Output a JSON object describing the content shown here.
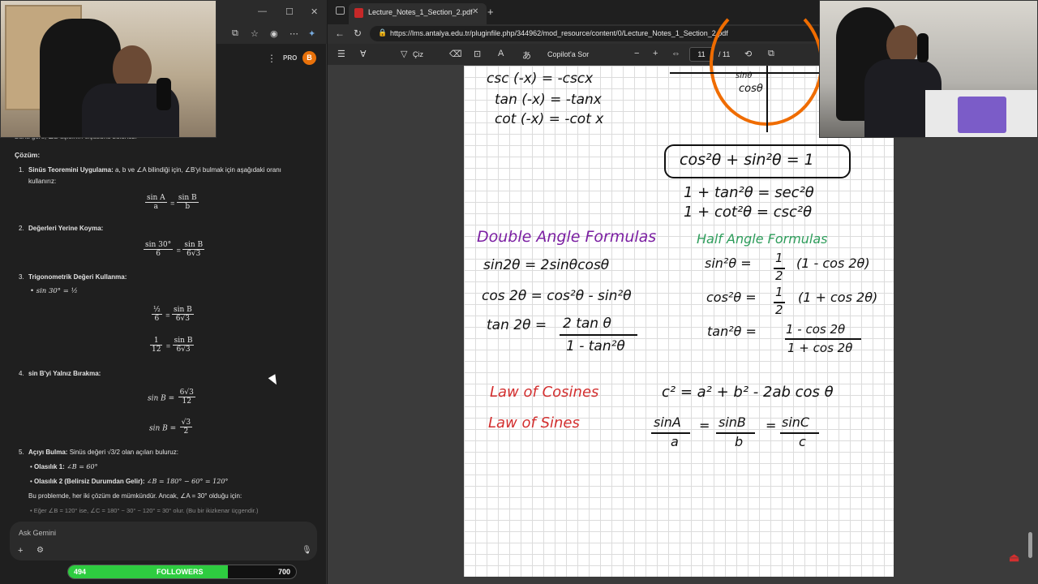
{
  "gemini": {
    "window_controls": [
      "—",
      "☐",
      "✕"
    ],
    "pro_label": "PRO",
    "avatar_letter": "B",
    "truncated_line": "Buna göre, ∠B açısının ölçüsünü bulunuz.",
    "solution_heading": "Çözüm:",
    "steps": {
      "s1_title": "Sinüs Teoremini Uygulama:",
      "s1_text": "a, b ve ∠A bilindiği için, ∠B'yi bulmak için aşağıdaki oranı",
      "s1_text2": "kullanırız:",
      "s1_eq_l_num": "sin A",
      "s1_eq_l_den": "a",
      "s1_eq_r_num": "sin B",
      "s1_eq_r_den": "b",
      "s2_title": "Değerleri Yerine Koyma:",
      "s2_eq_l_num": "sin 30°",
      "s2_eq_l_den": "6",
      "s2_eq_r_num": "sin B",
      "s2_eq_r_den": "6√3",
      "s3_title": "Trigonometrik Değeri Kullanma:",
      "s3_bullet": "sin 30° = ½",
      "s3_eq1_l_num": "½",
      "s3_eq1_l_den": "6",
      "s3_eq1_r_num": "sin B",
      "s3_eq1_r_den": "6√3",
      "s3_eq2_l_num": "1",
      "s3_eq2_l_den": "12",
      "s3_eq2_r_num": "sin B",
      "s3_eq2_r_den": "6√3",
      "s4_title": "sin B'yi Yalnız Bırakma:",
      "s4_eq1_l": "sin B =",
      "s4_eq1_num": "6√3",
      "s4_eq1_den": "12",
      "s4_eq2_l": "sin B =",
      "s4_eq2_num": "√3",
      "s4_eq2_den": "2",
      "s5_title": "Açıyı Bulma:",
      "s5_text": "Sinüs değeri √3/2 olan açıları buluruz:",
      "s5_b1_label": "Olasılık 1:",
      "s5_b1_val": "∠B = 60°",
      "s5_b2_label": "Olasılık 2 (Belirsiz Durumdan Gelir):",
      "s5_b2_val": "∠B = 180° − 60° = 120°",
      "s5_note": "Bu problemde, her iki çözüm de mümkündür. Ancak, ∠A = 30° olduğu için:",
      "s5_sub": "Eğer ∠B = 120° ise, ∠C = 180° − 30° − 120° = 30° olur. (Bu bir ikizkenar üçgendir.)"
    },
    "step_numbers": [
      "1.",
      "2.",
      "3.",
      "4.",
      "5."
    ],
    "ask_placeholder": "Ask Gemini"
  },
  "followers": {
    "left": "494",
    "label": "FOLLOWERS",
    "right": "700",
    "progress": 0.7
  },
  "browser": {
    "tab_title": "Lecture_Notes_1_Section_2.pdf",
    "url": "https://lms.antalya.edu.tr/pluginfile.php/344962/mod_resource/content/0/Lecture_Notes_1_Section_2.pdf",
    "toolbar": {
      "draw_label": "Çiz",
      "copilot_label": "Copilot'a Sor",
      "zoom_minus": "−",
      "zoom_plus": "+",
      "page_current": "11",
      "page_total": "/ 11"
    }
  },
  "notes": {
    "neg1": "csc (-x) = -cscx",
    "neg2": "tan (-x) = -tanx",
    "neg3": "cot (-x) = -cot x",
    "circle_label_top": "sinθ",
    "circle_label": "cosθ",
    "pyth1": "cos²θ + sin²θ = 1",
    "pyth2": "1 + tan²θ = sec²θ",
    "pyth3": "1 + cot²θ = csc²θ",
    "double_title": "Double Angle Formulas",
    "double1": "sin2θ = 2sinθcosθ",
    "double2": "cos 2θ = cos²θ - sin²θ",
    "double3_l": "tan 2θ =",
    "double3_num": "2 tan θ",
    "double3_den": "1 - tan²θ",
    "half_title": "Half Angle Formulas",
    "half1_l": "sin²θ =",
    "half1_r": "(1 - cos 2θ)",
    "half2_l": "cos²θ =",
    "half2_r": "(1 + cos 2θ)",
    "half_frac_num": "1",
    "half_frac_den": "2",
    "half3_l": "tan²θ =",
    "half3_num": "1 - cos 2θ",
    "half3_den": "1 + cos 2θ",
    "loc_label": "Law of Cosines",
    "loc_formula": "c² = a² + b² - 2ab cos θ",
    "los_label": "Law of Sines",
    "los_a_num": "sinA",
    "los_a_den": "a",
    "los_b_num": "sinB",
    "los_b_den": "b",
    "los_c_num": "sinC",
    "los_c_den": "c",
    "eq": "="
  },
  "colors": {
    "purple": "#7b1fa2",
    "green": "#2e9d5b",
    "red": "#d32f2f",
    "orange": "#ef6c00",
    "followers_fill": "#2ecc40"
  }
}
